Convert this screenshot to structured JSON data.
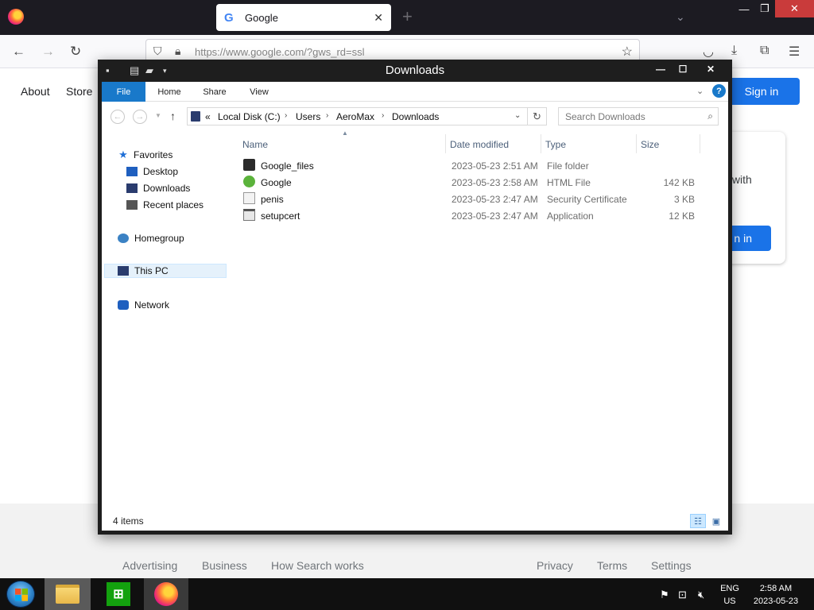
{
  "browser": {
    "tab_title": "Google",
    "tab_close": "✕",
    "new_tab": "+",
    "url": "https://www.google.com/?gws_rd=ssl",
    "window_controls": {
      "minimize": "—",
      "maximize": "❐",
      "close": "✕"
    }
  },
  "google": {
    "about": "About",
    "store": "Store",
    "sign_in": "Sign in",
    "card_text": "y with",
    "card_button": "n in",
    "footer_links": [
      "Advertising",
      "Business",
      "How Search works",
      "Privacy",
      "Terms",
      "Settings"
    ]
  },
  "explorer": {
    "title": "Downloads",
    "window_controls": {
      "minimize": "—",
      "maximize": "☐",
      "close": "✕"
    },
    "ribbon_tabs": [
      "File",
      "Home",
      "Share",
      "View"
    ],
    "help": "?",
    "address": {
      "prefix": "«",
      "items": [
        "Local Disk (C:)",
        "Users",
        "AeroMax",
        "Downloads"
      ]
    },
    "search_placeholder": "Search Downloads",
    "nav": {
      "favorites": "Favorites",
      "desktop": "Desktop",
      "downloads": "Downloads",
      "recent": "Recent places",
      "homegroup": "Homegroup",
      "this_pc": "This PC",
      "network": "Network"
    },
    "columns": {
      "name": "Name",
      "date": "Date modified",
      "type": "Type",
      "size": "Size"
    },
    "files": [
      {
        "name": "Google_files",
        "date": "2023-05-23 2:51 AM",
        "type": "File folder",
        "size": "",
        "icon": "folder-icon"
      },
      {
        "name": "Google",
        "date": "2023-05-23 2:58 AM",
        "type": "HTML File",
        "size": "142 KB",
        "icon": "html-file-icon"
      },
      {
        "name": "penis",
        "date": "2023-05-23 2:47 AM",
        "type": "Security Certificate",
        "size": "3 KB",
        "icon": "certificate-icon"
      },
      {
        "name": "setupcert",
        "date": "2023-05-23 2:47 AM",
        "type": "Application",
        "size": "12 KB",
        "icon": "application-icon"
      }
    ],
    "status": "4 items"
  },
  "taskbar": {
    "store_glyph": "⊞",
    "lang_line1": "ENG",
    "lang_line2": "US",
    "time": "2:58 AM",
    "date": "2023-05-23"
  },
  "colors": {
    "accent": "#1979ca",
    "google_blue": "#1a73e8",
    "taskbar": "#101010"
  }
}
